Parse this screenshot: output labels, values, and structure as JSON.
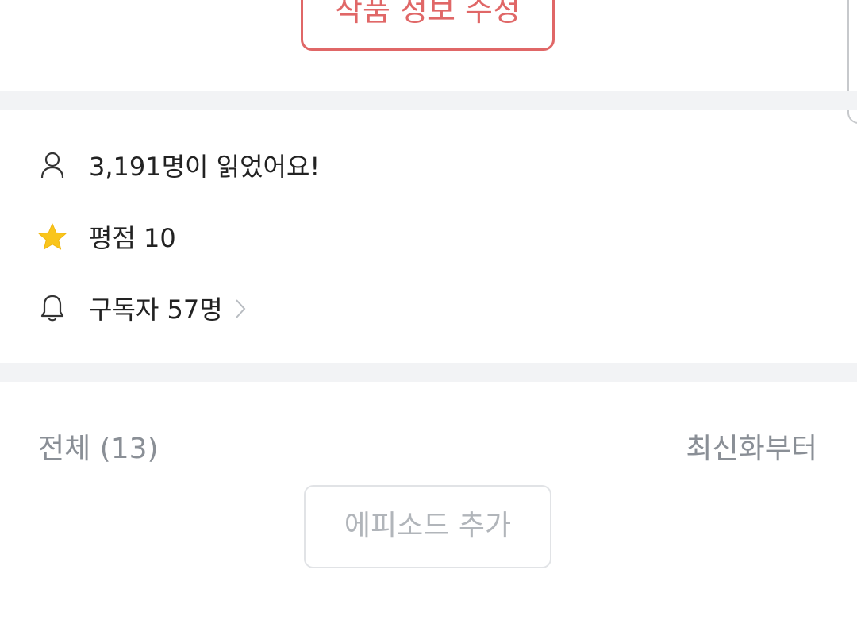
{
  "header": {
    "edit_work_label": "작품 정보 수정"
  },
  "stats": {
    "readers_text": "3,191명이 읽었어요!",
    "rating_text": "평점 10",
    "subscribers_text": "구독자 57명"
  },
  "episodes": {
    "total_label": "전체 (13)",
    "sort_label": "최신화부터",
    "add_label": "에피소드 추가"
  },
  "icons": {
    "readers": "person-icon",
    "rating": "star-icon",
    "subscribers": "bell-icon",
    "subscribers_arrow": "chevron-right-icon"
  },
  "colors": {
    "accent": "#e06767",
    "star": "#f9c51c",
    "muted_text": "#8a8f96",
    "divider": "#f2f3f5"
  }
}
